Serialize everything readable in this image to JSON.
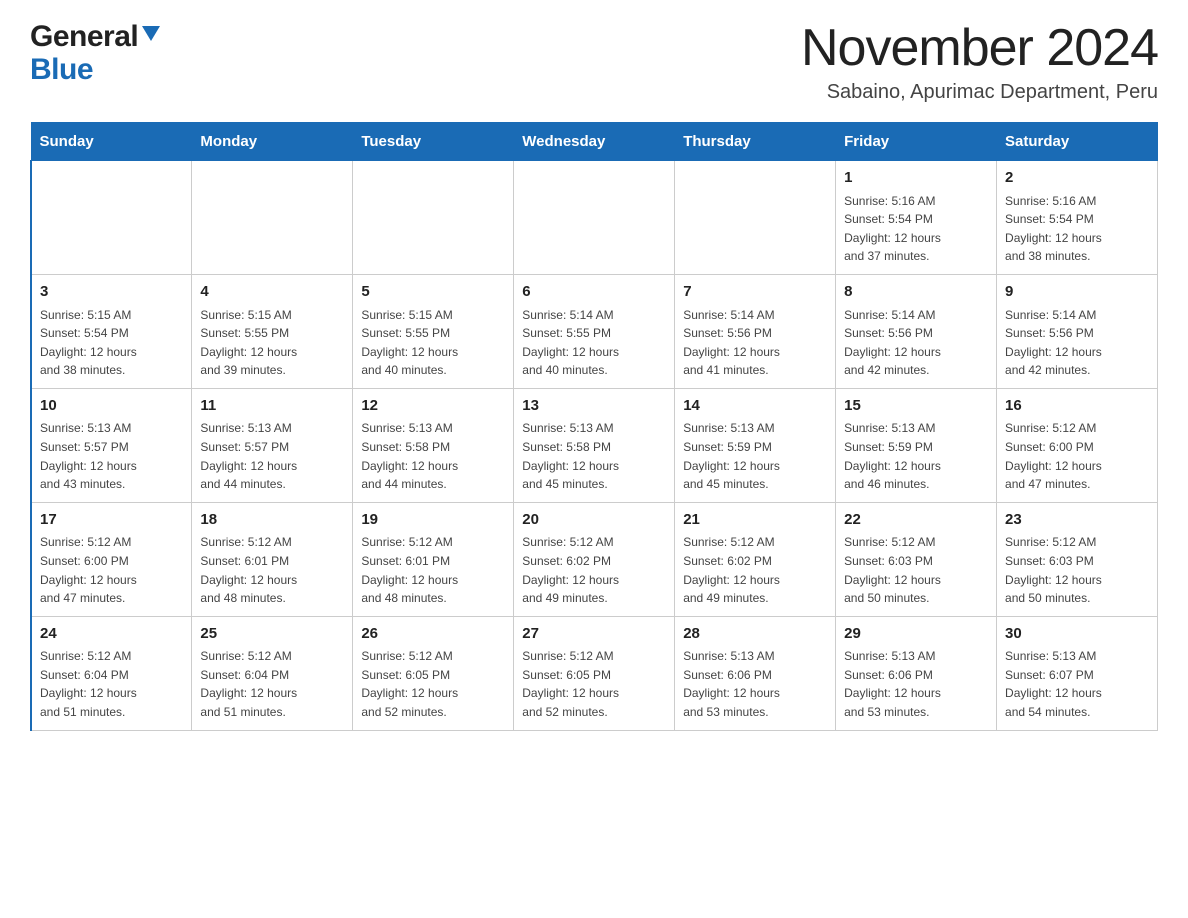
{
  "header": {
    "logo_general": "General",
    "logo_blue": "Blue",
    "month_title": "November 2024",
    "location": "Sabaino, Apurimac Department, Peru"
  },
  "weekdays": [
    "Sunday",
    "Monday",
    "Tuesday",
    "Wednesday",
    "Thursday",
    "Friday",
    "Saturday"
  ],
  "weeks": [
    [
      {
        "day": "",
        "info": ""
      },
      {
        "day": "",
        "info": ""
      },
      {
        "day": "",
        "info": ""
      },
      {
        "day": "",
        "info": ""
      },
      {
        "day": "",
        "info": ""
      },
      {
        "day": "1",
        "info": "Sunrise: 5:16 AM\nSunset: 5:54 PM\nDaylight: 12 hours\nand 37 minutes."
      },
      {
        "day": "2",
        "info": "Sunrise: 5:16 AM\nSunset: 5:54 PM\nDaylight: 12 hours\nand 38 minutes."
      }
    ],
    [
      {
        "day": "3",
        "info": "Sunrise: 5:15 AM\nSunset: 5:54 PM\nDaylight: 12 hours\nand 38 minutes."
      },
      {
        "day": "4",
        "info": "Sunrise: 5:15 AM\nSunset: 5:55 PM\nDaylight: 12 hours\nand 39 minutes."
      },
      {
        "day": "5",
        "info": "Sunrise: 5:15 AM\nSunset: 5:55 PM\nDaylight: 12 hours\nand 40 minutes."
      },
      {
        "day": "6",
        "info": "Sunrise: 5:14 AM\nSunset: 5:55 PM\nDaylight: 12 hours\nand 40 minutes."
      },
      {
        "day": "7",
        "info": "Sunrise: 5:14 AM\nSunset: 5:56 PM\nDaylight: 12 hours\nand 41 minutes."
      },
      {
        "day": "8",
        "info": "Sunrise: 5:14 AM\nSunset: 5:56 PM\nDaylight: 12 hours\nand 42 minutes."
      },
      {
        "day": "9",
        "info": "Sunrise: 5:14 AM\nSunset: 5:56 PM\nDaylight: 12 hours\nand 42 minutes."
      }
    ],
    [
      {
        "day": "10",
        "info": "Sunrise: 5:13 AM\nSunset: 5:57 PM\nDaylight: 12 hours\nand 43 minutes."
      },
      {
        "day": "11",
        "info": "Sunrise: 5:13 AM\nSunset: 5:57 PM\nDaylight: 12 hours\nand 44 minutes."
      },
      {
        "day": "12",
        "info": "Sunrise: 5:13 AM\nSunset: 5:58 PM\nDaylight: 12 hours\nand 44 minutes."
      },
      {
        "day": "13",
        "info": "Sunrise: 5:13 AM\nSunset: 5:58 PM\nDaylight: 12 hours\nand 45 minutes."
      },
      {
        "day": "14",
        "info": "Sunrise: 5:13 AM\nSunset: 5:59 PM\nDaylight: 12 hours\nand 45 minutes."
      },
      {
        "day": "15",
        "info": "Sunrise: 5:13 AM\nSunset: 5:59 PM\nDaylight: 12 hours\nand 46 minutes."
      },
      {
        "day": "16",
        "info": "Sunrise: 5:12 AM\nSunset: 6:00 PM\nDaylight: 12 hours\nand 47 minutes."
      }
    ],
    [
      {
        "day": "17",
        "info": "Sunrise: 5:12 AM\nSunset: 6:00 PM\nDaylight: 12 hours\nand 47 minutes."
      },
      {
        "day": "18",
        "info": "Sunrise: 5:12 AM\nSunset: 6:01 PM\nDaylight: 12 hours\nand 48 minutes."
      },
      {
        "day": "19",
        "info": "Sunrise: 5:12 AM\nSunset: 6:01 PM\nDaylight: 12 hours\nand 48 minutes."
      },
      {
        "day": "20",
        "info": "Sunrise: 5:12 AM\nSunset: 6:02 PM\nDaylight: 12 hours\nand 49 minutes."
      },
      {
        "day": "21",
        "info": "Sunrise: 5:12 AM\nSunset: 6:02 PM\nDaylight: 12 hours\nand 49 minutes."
      },
      {
        "day": "22",
        "info": "Sunrise: 5:12 AM\nSunset: 6:03 PM\nDaylight: 12 hours\nand 50 minutes."
      },
      {
        "day": "23",
        "info": "Sunrise: 5:12 AM\nSunset: 6:03 PM\nDaylight: 12 hours\nand 50 minutes."
      }
    ],
    [
      {
        "day": "24",
        "info": "Sunrise: 5:12 AM\nSunset: 6:04 PM\nDaylight: 12 hours\nand 51 minutes."
      },
      {
        "day": "25",
        "info": "Sunrise: 5:12 AM\nSunset: 6:04 PM\nDaylight: 12 hours\nand 51 minutes."
      },
      {
        "day": "26",
        "info": "Sunrise: 5:12 AM\nSunset: 6:05 PM\nDaylight: 12 hours\nand 52 minutes."
      },
      {
        "day": "27",
        "info": "Sunrise: 5:12 AM\nSunset: 6:05 PM\nDaylight: 12 hours\nand 52 minutes."
      },
      {
        "day": "28",
        "info": "Sunrise: 5:13 AM\nSunset: 6:06 PM\nDaylight: 12 hours\nand 53 minutes."
      },
      {
        "day": "29",
        "info": "Sunrise: 5:13 AM\nSunset: 6:06 PM\nDaylight: 12 hours\nand 53 minutes."
      },
      {
        "day": "30",
        "info": "Sunrise: 5:13 AM\nSunset: 6:07 PM\nDaylight: 12 hours\nand 54 minutes."
      }
    ]
  ]
}
